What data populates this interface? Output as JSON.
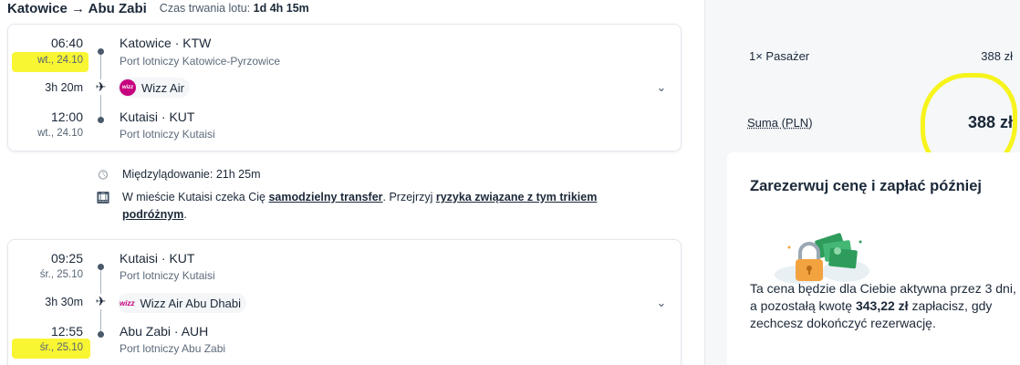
{
  "header": {
    "route_title": "Katowice → Abu Zabi",
    "duration_label": "Czas trwania lotu:",
    "duration_value": "1d 4h 15m"
  },
  "segments": [
    {
      "dep_time": "06:40",
      "dep_date": "wt., 24.10",
      "dep_airport": "Katowice · KTW",
      "dep_airport_full": "Port lotniczy Katowice-Pyrzowice",
      "leg_duration": "3h 20m",
      "carrier": "Wizz Air",
      "arr_time": "12:00",
      "arr_date": "wt., 24.10",
      "arr_airport": "Kutaisi · KUT",
      "arr_airport_full": "Port lotniczy Kutaisi"
    },
    {
      "dep_time": "09:25",
      "dep_date": "śr., 25.10",
      "dep_airport": "Kutaisi · KUT",
      "dep_airport_full": "Port lotniczy Kutaisi",
      "leg_duration": "3h 30m",
      "carrier": "Wizz Air Abu Dhabi",
      "arr_time": "12:55",
      "arr_date": "śr., 25.10",
      "arr_airport": "Abu Zabi · AUH",
      "arr_airport_full": "Port lotniczy Abu Zabi"
    }
  ],
  "layover": {
    "stop_text": "Międzylądowanie: 21h 25m",
    "transfer_pre": "W mieście Kutaisi czeka Cię ",
    "transfer_link": "samodzielny transfer",
    "transfer_mid": ". Przejrzyj ",
    "risk_link_1": "ryzyka związane z tym trikiem",
    "risk_link_2": "podróżnym",
    "transfer_end": "."
  },
  "summary": {
    "passenger_label": "1× Pasażer",
    "passenger_price": "388 zł",
    "total_label": "Suma (PLN)",
    "total_price": "388 zł"
  },
  "reserve": {
    "title": "Zarezerwuj cenę i zapłać później",
    "text_pre": "Ta cena będzie dla Ciebie aktywna przez 3 dni, a pozostałą kwotę ",
    "text_amount": "343,22 zł",
    "text_post": " zapłacisz, gdy zechcesz dokończyć rezerwację."
  },
  "logos": {
    "wizz": "wizz"
  },
  "colors": {
    "highlight": "#f7f41c",
    "wizz_brand": "#c6007e",
    "text": "#1b2838"
  }
}
